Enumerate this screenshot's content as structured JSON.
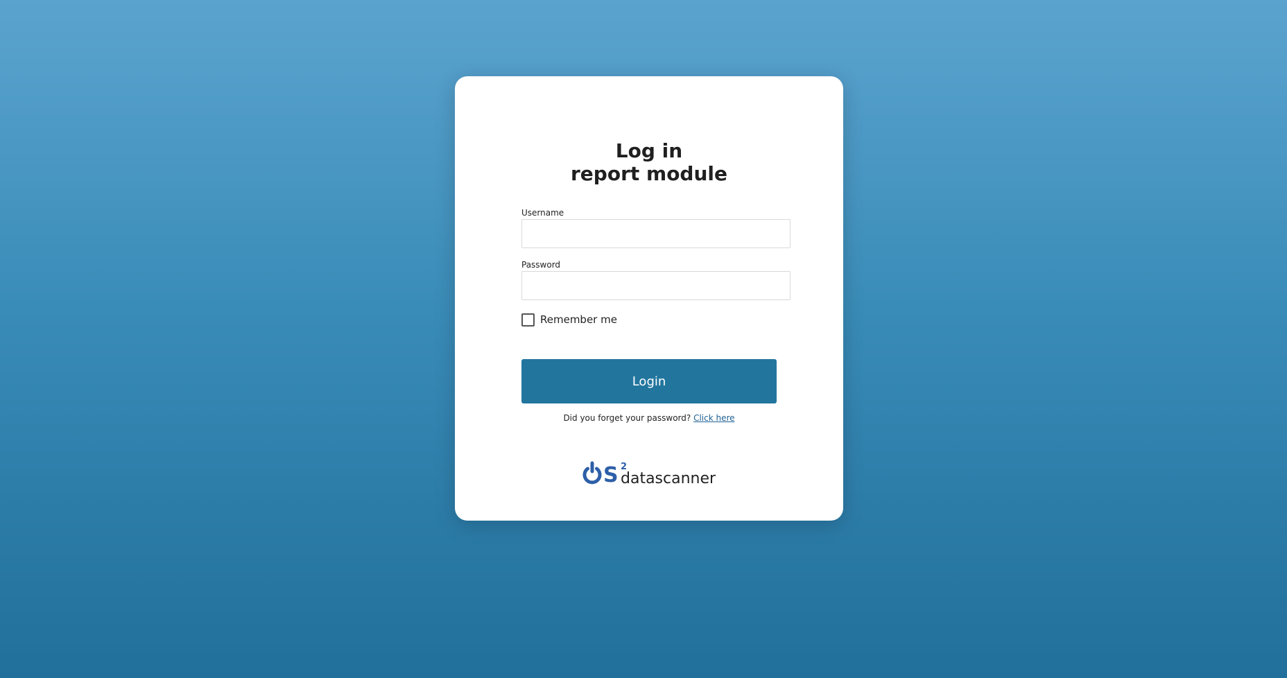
{
  "title": {
    "line1": "Log in",
    "line2": "report module"
  },
  "form": {
    "username_label": "Username",
    "username_value": "",
    "password_label": "Password",
    "password_value": "",
    "remember_label": "Remember me",
    "remember_checked": false,
    "login_label": "Login"
  },
  "forgot": {
    "prompt": "Did you forget your password?",
    "link_text": "Click here"
  },
  "logo": {
    "brand": "OS",
    "superscript": "2",
    "product": "datascanner"
  },
  "colors": {
    "accent": "#22769e",
    "link": "#1e5f92",
    "logo_blue": "#2d5fa8"
  }
}
